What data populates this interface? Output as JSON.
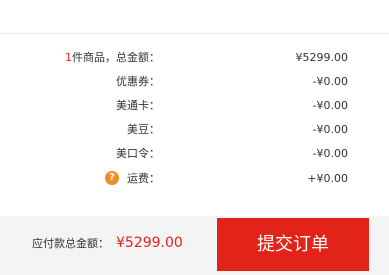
{
  "summary": {
    "items_count": "1",
    "items_label": "件商品，总金额：",
    "items_total": "¥5299.00",
    "rows": [
      {
        "label": "优惠券：",
        "value": "-¥0.00"
      },
      {
        "label": "美通卡：",
        "value": "-¥0.00"
      },
      {
        "label": "美豆：",
        "value": "-¥0.00"
      },
      {
        "label": "美口令：",
        "value": "-¥0.00"
      }
    ],
    "shipping_label": "运费：",
    "shipping_value": "+¥0.00",
    "help_icon_glyph": "?"
  },
  "footer": {
    "total_label": "应付款总金额：",
    "total_amount": "¥5299.00",
    "submit_label": "提交订单"
  },
  "colors": {
    "accent": "#e2231a",
    "help_icon": "#f08c27",
    "footer_bg": "#f4f4f4"
  }
}
